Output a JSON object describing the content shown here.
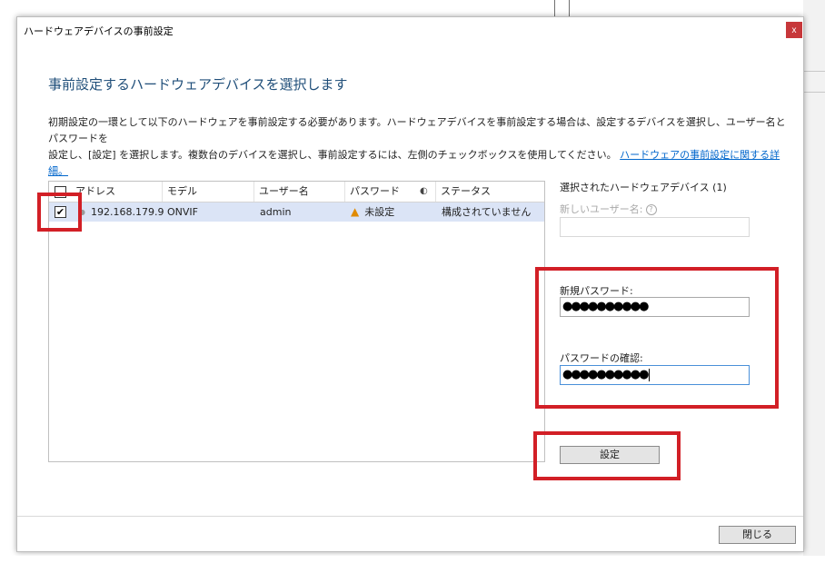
{
  "dialog": {
    "title": "ハードウェアデバイスの事前設定",
    "close_glyph": "x"
  },
  "page": {
    "heading": "事前設定するハードウェアデバイスを選択します",
    "desc_line1": "初期設定の一環として以下のハードウェアを事前設定する必要があります。ハードウェアデバイスを事前設定する場合は、設定するデバイスを選択し、ユーザー名とパスワードを",
    "desc_line2": "設定し、[設定] を選択します。複数台のデバイスを選択し、事前設定するには、左側のチェックボックスを使用してください。",
    "help_link": "ハードウェアの事前設定に関する詳細。"
  },
  "table": {
    "columns": {
      "address": "アドレス",
      "model": "モデル",
      "username": "ユーザー名",
      "password": "パスワード",
      "status": "ステータス"
    },
    "rows": [
      {
        "checked": "✔",
        "address": "192.168.179.9",
        "model": "ONVIF",
        "username": "admin",
        "password": "未設定",
        "status": "構成されていません"
      }
    ]
  },
  "panel": {
    "title": "選択されたハードウェアデバイス (1)",
    "new_username_label": "新しいユーザー名:",
    "new_username_value": "",
    "new_password_label": "新規パスワード:",
    "new_password_value": "●●●●●●●●●●",
    "confirm_password_label": "パスワードの確認:",
    "confirm_password_value": "●●●●●●●●●●",
    "apply_button": "設定"
  },
  "footer": {
    "close_button": "閉じる"
  },
  "colors": {
    "highlight": "#d21f26",
    "heading": "#1f4e79",
    "link": "#0066cc",
    "row_selected": "#dbe4f6"
  }
}
